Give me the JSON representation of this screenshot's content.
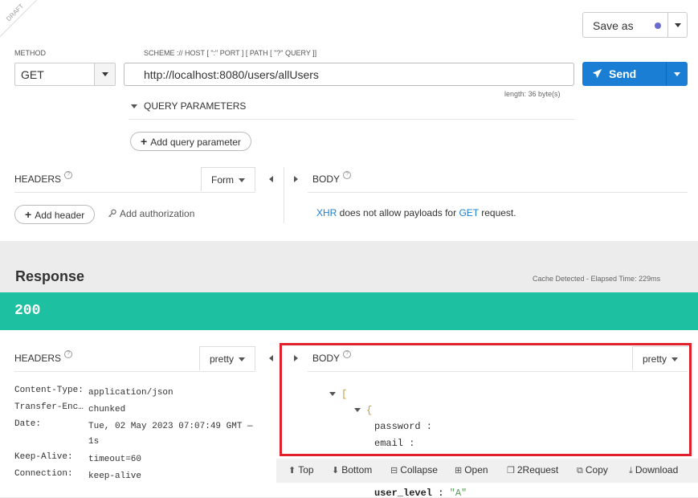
{
  "draft_label": "DRAFT",
  "save_as": {
    "label": "Save as"
  },
  "method": {
    "label": "METHOD",
    "value": "GET"
  },
  "url": {
    "label": "SCHEME :// HOST [ \":\" PORT ] [ PATH [ \"?\" QUERY ]]",
    "value": "http://localhost:8080/users/allUsers",
    "length": "length: 36 byte(s)"
  },
  "send": {
    "label": "Send"
  },
  "query": {
    "toggle_label": "QUERY PARAMETERS",
    "add_label": "Add query parameter"
  },
  "request_headers": {
    "title": "HEADERS",
    "mode": "Form",
    "add_label": "Add header",
    "auth_label": "Add authorization"
  },
  "request_body": {
    "title": "BODY",
    "message_xhr": "XHR",
    "message_mid": " does not allow payloads for ",
    "message_get": "GET",
    "message_end": " request."
  },
  "response": {
    "title": "Response",
    "cache_info": "Cache Detected - Elapsed Time: 229ms",
    "status": "200",
    "headers_title": "HEADERS",
    "headers_mode": "pretty",
    "body_title": "BODY",
    "body_mode": "pretty",
    "headers": [
      {
        "key": "Content-Type:",
        "value": "application/json"
      },
      {
        "key": "Transfer-Enc…",
        "value": "chunked"
      },
      {
        "key": "Date:",
        "value": "Tue, 02 May 2023 07:07:49 GMT — 1s"
      },
      {
        "key": "Keep-Alive:",
        "value": "timeout=60"
      },
      {
        "key": "Connection:",
        "value": "keep-alive"
      }
    ],
    "json": {
      "open_array": "[",
      "open_object": "{",
      "key_password": "password :",
      "key_email": "email :",
      "key_user_level": "user_level :",
      "val_user_level": "\"A\""
    },
    "toolbar": {
      "top": "Top",
      "bottom": "Bottom",
      "collapse": "Collapse",
      "open": "Open",
      "to_request": "2Request",
      "copy": "Copy",
      "download": "Download"
    }
  }
}
